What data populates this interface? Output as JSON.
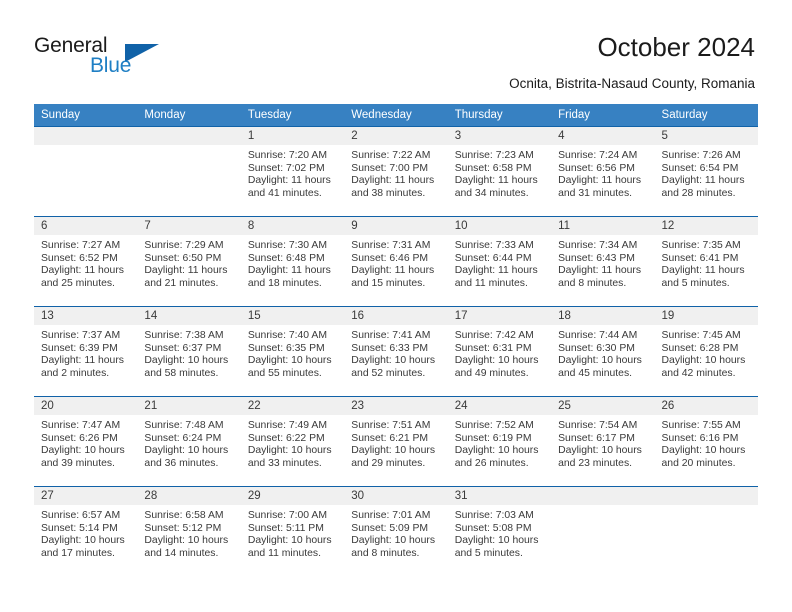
{
  "brand": {
    "name_part1": "General",
    "name_part2": "Blue",
    "triangle_color": "#1062a8",
    "blue_color": "#1f7fc4"
  },
  "header": {
    "title": "October 2024",
    "subtitle": "Ocnita, Bistrita-Nasaud County, Romania"
  },
  "colors": {
    "header_row_bg": "#3781c2",
    "header_row_text": "#ffffff",
    "row_rule": "#1062a8",
    "daynum_band_bg": "#f0f0f0",
    "body_text": "#3a3a3a"
  },
  "calendar": {
    "weekdays": [
      "Sunday",
      "Monday",
      "Tuesday",
      "Wednesday",
      "Thursday",
      "Friday",
      "Saturday"
    ],
    "weeks": [
      [
        {
          "day": "",
          "sunrise": "",
          "sunset": "",
          "daylight": "",
          "empty": true
        },
        {
          "day": "",
          "sunrise": "",
          "sunset": "",
          "daylight": "",
          "empty": true
        },
        {
          "day": "1",
          "sunrise": "Sunrise: 7:20 AM",
          "sunset": "Sunset: 7:02 PM",
          "daylight": "Daylight: 11 hours and 41 minutes."
        },
        {
          "day": "2",
          "sunrise": "Sunrise: 7:22 AM",
          "sunset": "Sunset: 7:00 PM",
          "daylight": "Daylight: 11 hours and 38 minutes."
        },
        {
          "day": "3",
          "sunrise": "Sunrise: 7:23 AM",
          "sunset": "Sunset: 6:58 PM",
          "daylight": "Daylight: 11 hours and 34 minutes."
        },
        {
          "day": "4",
          "sunrise": "Sunrise: 7:24 AM",
          "sunset": "Sunset: 6:56 PM",
          "daylight": "Daylight: 11 hours and 31 minutes."
        },
        {
          "day": "5",
          "sunrise": "Sunrise: 7:26 AM",
          "sunset": "Sunset: 6:54 PM",
          "daylight": "Daylight: 11 hours and 28 minutes."
        }
      ],
      [
        {
          "day": "6",
          "sunrise": "Sunrise: 7:27 AM",
          "sunset": "Sunset: 6:52 PM",
          "daylight": "Daylight: 11 hours and 25 minutes."
        },
        {
          "day": "7",
          "sunrise": "Sunrise: 7:29 AM",
          "sunset": "Sunset: 6:50 PM",
          "daylight": "Daylight: 11 hours and 21 minutes."
        },
        {
          "day": "8",
          "sunrise": "Sunrise: 7:30 AM",
          "sunset": "Sunset: 6:48 PM",
          "daylight": "Daylight: 11 hours and 18 minutes."
        },
        {
          "day": "9",
          "sunrise": "Sunrise: 7:31 AM",
          "sunset": "Sunset: 6:46 PM",
          "daylight": "Daylight: 11 hours and 15 minutes."
        },
        {
          "day": "10",
          "sunrise": "Sunrise: 7:33 AM",
          "sunset": "Sunset: 6:44 PM",
          "daylight": "Daylight: 11 hours and 11 minutes."
        },
        {
          "day": "11",
          "sunrise": "Sunrise: 7:34 AM",
          "sunset": "Sunset: 6:43 PM",
          "daylight": "Daylight: 11 hours and 8 minutes."
        },
        {
          "day": "12",
          "sunrise": "Sunrise: 7:35 AM",
          "sunset": "Sunset: 6:41 PM",
          "daylight": "Daylight: 11 hours and 5 minutes."
        }
      ],
      [
        {
          "day": "13",
          "sunrise": "Sunrise: 7:37 AM",
          "sunset": "Sunset: 6:39 PM",
          "daylight": "Daylight: 11 hours and 2 minutes."
        },
        {
          "day": "14",
          "sunrise": "Sunrise: 7:38 AM",
          "sunset": "Sunset: 6:37 PM",
          "daylight": "Daylight: 10 hours and 58 minutes."
        },
        {
          "day": "15",
          "sunrise": "Sunrise: 7:40 AM",
          "sunset": "Sunset: 6:35 PM",
          "daylight": "Daylight: 10 hours and 55 minutes."
        },
        {
          "day": "16",
          "sunrise": "Sunrise: 7:41 AM",
          "sunset": "Sunset: 6:33 PM",
          "daylight": "Daylight: 10 hours and 52 minutes."
        },
        {
          "day": "17",
          "sunrise": "Sunrise: 7:42 AM",
          "sunset": "Sunset: 6:31 PM",
          "daylight": "Daylight: 10 hours and 49 minutes."
        },
        {
          "day": "18",
          "sunrise": "Sunrise: 7:44 AM",
          "sunset": "Sunset: 6:30 PM",
          "daylight": "Daylight: 10 hours and 45 minutes."
        },
        {
          "day": "19",
          "sunrise": "Sunrise: 7:45 AM",
          "sunset": "Sunset: 6:28 PM",
          "daylight": "Daylight: 10 hours and 42 minutes."
        }
      ],
      [
        {
          "day": "20",
          "sunrise": "Sunrise: 7:47 AM",
          "sunset": "Sunset: 6:26 PM",
          "daylight": "Daylight: 10 hours and 39 minutes."
        },
        {
          "day": "21",
          "sunrise": "Sunrise: 7:48 AM",
          "sunset": "Sunset: 6:24 PM",
          "daylight": "Daylight: 10 hours and 36 minutes."
        },
        {
          "day": "22",
          "sunrise": "Sunrise: 7:49 AM",
          "sunset": "Sunset: 6:22 PM",
          "daylight": "Daylight: 10 hours and 33 minutes."
        },
        {
          "day": "23",
          "sunrise": "Sunrise: 7:51 AM",
          "sunset": "Sunset: 6:21 PM",
          "daylight": "Daylight: 10 hours and 29 minutes."
        },
        {
          "day": "24",
          "sunrise": "Sunrise: 7:52 AM",
          "sunset": "Sunset: 6:19 PM",
          "daylight": "Daylight: 10 hours and 26 minutes."
        },
        {
          "day": "25",
          "sunrise": "Sunrise: 7:54 AM",
          "sunset": "Sunset: 6:17 PM",
          "daylight": "Daylight: 10 hours and 23 minutes."
        },
        {
          "day": "26",
          "sunrise": "Sunrise: 7:55 AM",
          "sunset": "Sunset: 6:16 PM",
          "daylight": "Daylight: 10 hours and 20 minutes."
        }
      ],
      [
        {
          "day": "27",
          "sunrise": "Sunrise: 6:57 AM",
          "sunset": "Sunset: 5:14 PM",
          "daylight": "Daylight: 10 hours and 17 minutes."
        },
        {
          "day": "28",
          "sunrise": "Sunrise: 6:58 AM",
          "sunset": "Sunset: 5:12 PM",
          "daylight": "Daylight: 10 hours and 14 minutes."
        },
        {
          "day": "29",
          "sunrise": "Sunrise: 7:00 AM",
          "sunset": "Sunset: 5:11 PM",
          "daylight": "Daylight: 10 hours and 11 minutes."
        },
        {
          "day": "30",
          "sunrise": "Sunrise: 7:01 AM",
          "sunset": "Sunset: 5:09 PM",
          "daylight": "Daylight: 10 hours and 8 minutes."
        },
        {
          "day": "31",
          "sunrise": "Sunrise: 7:03 AM",
          "sunset": "Sunset: 5:08 PM",
          "daylight": "Daylight: 10 hours and 5 minutes."
        },
        {
          "day": "",
          "sunrise": "",
          "sunset": "",
          "daylight": "",
          "empty": true,
          "tail": true
        },
        {
          "day": "",
          "sunrise": "",
          "sunset": "",
          "daylight": "",
          "empty": true,
          "tail": true
        }
      ]
    ]
  }
}
